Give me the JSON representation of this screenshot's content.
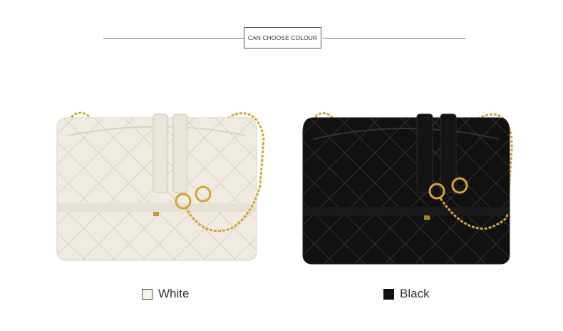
{
  "header": {
    "title": "CAN CHOOSE COLOUR"
  },
  "colors": {
    "white_bag": "#efebe2",
    "black_bag": "#0d0d0d",
    "gold_chain": "#d6a531",
    "rule": "#6f6f6f"
  },
  "options": [
    {
      "label": "White",
      "swatch": "#f6f1e9"
    },
    {
      "label": "Black",
      "swatch": "#111111"
    }
  ]
}
